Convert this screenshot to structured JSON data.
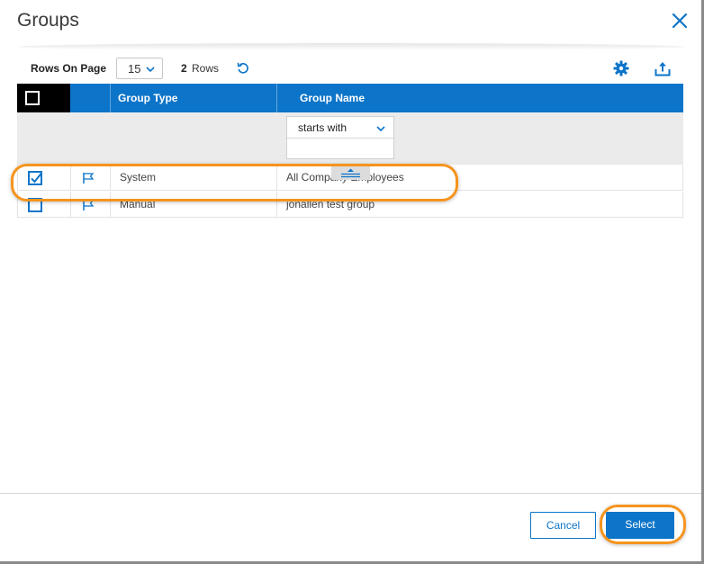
{
  "dialog": {
    "title": "Groups",
    "close_icon": "close-icon"
  },
  "toolbar": {
    "rows_on_page_label": "Rows On Page",
    "rows_on_page_value": "15",
    "row_count": "2",
    "rows_word": "Rows",
    "icons": [
      "refresh-icon",
      "gear-icon",
      "upload-icon"
    ]
  },
  "grid": {
    "columns": [
      "Group Type",
      "Group Name"
    ],
    "filter": {
      "mode": "starts with",
      "value": ""
    },
    "rows": [
      {
        "checked": true,
        "group_type": "System",
        "group_name": "All Company Employees"
      },
      {
        "checked": false,
        "group_type": "Manual",
        "group_name": "jonallen test group"
      }
    ]
  },
  "footer": {
    "cancel_label": "Cancel",
    "select_label": "Select"
  },
  "colors": {
    "accent": "#0d75c9",
    "highlight": "#f5941e",
    "header_check_cell": "#000000"
  }
}
